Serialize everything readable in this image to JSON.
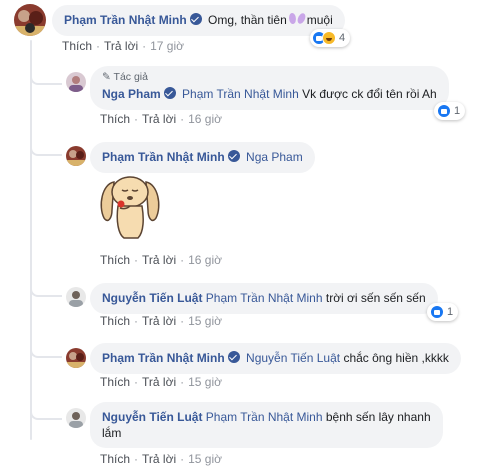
{
  "actions": {
    "like": "Thích",
    "reply": "Trả lời",
    "separator": "·"
  },
  "comments": [
    {
      "author": "Phạm Trần Nhật Minh",
      "text_before": "Omg, thần tiên",
      "text_after": "muội",
      "emoji": "butterfly",
      "time": "17 giờ",
      "reactions": {
        "icons": [
          "like",
          "haha"
        ],
        "count": "4"
      }
    },
    {
      "badge": "Tác giả",
      "author": "Nga Pham",
      "mention": "Phạm Trần Nhật Minh",
      "text": "Vk được ck đổi tên rồi Ah",
      "time": "16 giờ",
      "reactions": {
        "icons": [
          "like"
        ],
        "count": "1"
      }
    },
    {
      "author": "Phạm Trần Nhật Minh",
      "mention": "Nga Pham",
      "sticker": "puppy-sticker",
      "time": "16 giờ"
    },
    {
      "author": "Nguyễn Tiến Luật",
      "mention": "Phạm Trần Nhật Minh",
      "text": "trời ơi sến sến sến",
      "time": "15 giờ",
      "reactions": {
        "icons": [
          "like"
        ],
        "count": "1"
      }
    },
    {
      "author": "Phạm Trần Nhật Minh",
      "mention": "Nguyễn Tiến Luật",
      "text": "chắc ông hiền ,kkkk",
      "time": "15 giờ"
    },
    {
      "author": "Nguyễn Tiến Luật",
      "mention": "Phạm Trần Nhật Minh",
      "text_line1": "bệnh sến lây nhanh",
      "text_line2": "lắm",
      "time": "15 giờ"
    }
  ]
}
